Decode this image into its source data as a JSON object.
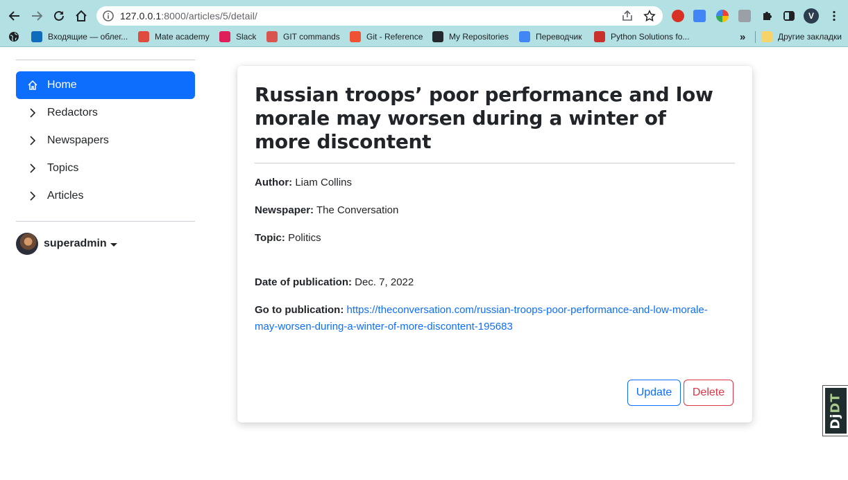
{
  "browser": {
    "url_host": "127.0.0.1",
    "url_rest": ":8000/articles/5/detail/",
    "profile_initial": "V",
    "bookmarks": [
      {
        "label": "Входящие — облег...",
        "icon": "outlook-icon",
        "color": "#0f6cbd"
      },
      {
        "label": "Mate academy",
        "icon": "mate-academy-icon",
        "color": "#e04b3f"
      },
      {
        "label": "Slack",
        "icon": "slack-icon",
        "color": "#e01e5a"
      },
      {
        "label": "GIT commands",
        "icon": "git-commands-icon",
        "color": "#d9534f"
      },
      {
        "label": "Git - Reference",
        "icon": "git-icon",
        "color": "#f05133"
      },
      {
        "label": "My Repositories",
        "icon": "github-icon",
        "color": "#24292f"
      },
      {
        "label": "Переводчик",
        "icon": "google-translate-icon",
        "color": "#4285f4"
      },
      {
        "label": "Python Solutions fo...",
        "icon": "python-solutions-icon",
        "color": "#c9302c"
      }
    ],
    "more_bookmarks_label": "»",
    "other_bookmarks": "Другие закладки"
  },
  "sidebar": {
    "items": [
      {
        "label": "Home",
        "icon": "home-icon",
        "active": true
      },
      {
        "label": "Redactors",
        "icon": "chevron-right-icon"
      },
      {
        "label": "Newspapers",
        "icon": "chevron-right-icon"
      },
      {
        "label": "Topics",
        "icon": "chevron-right-icon"
      },
      {
        "label": "Articles",
        "icon": "chevron-right-icon"
      }
    ],
    "username": "superadmin"
  },
  "article": {
    "title": "Russian troops’ poor performance and low morale may worsen during a winter of more discontent",
    "author_label": "Author:",
    "author": "Liam Collins",
    "newspaper_label": "Newspaper:",
    "newspaper": "The Conversation",
    "topic_label": "Topic:",
    "topic": "Politics",
    "date_label": "Date of publication:",
    "date": "Dec. 7, 2022",
    "link_label": "Go to publication:",
    "link": "https://theconversation.com/russian-troops-poor-performance-and-low-morale-may-worsen-during-a-winter-of-more-discontent-195683",
    "update_label": "Update",
    "delete_label": "Delete"
  },
  "debug_toolbar": {
    "label_dj": "Dj",
    "label_dt": "DT"
  }
}
